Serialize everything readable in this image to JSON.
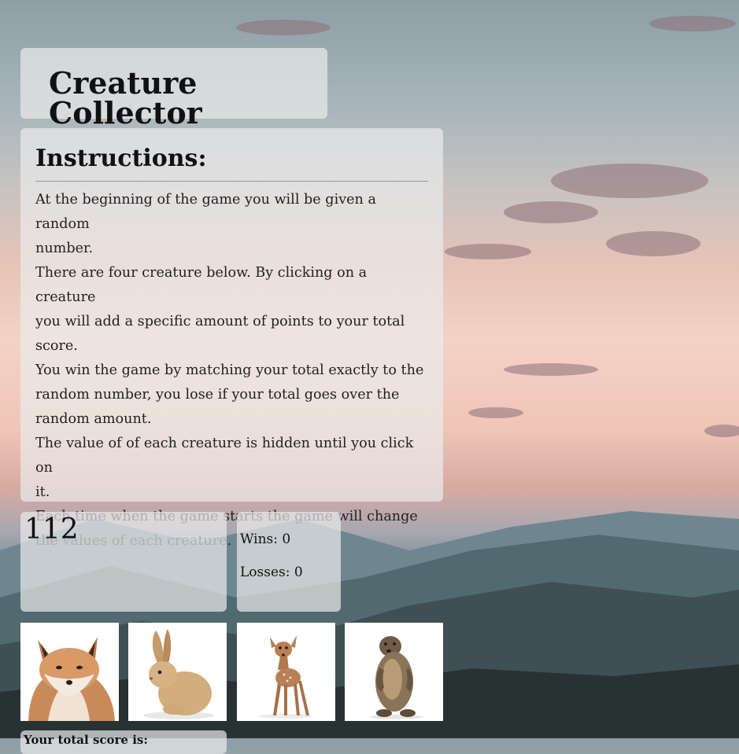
{
  "app": {
    "title": "Creature Collector"
  },
  "instructions": {
    "heading": "Instructions:",
    "lines": [
      "At the beginning of the game you will be given a random",
      "number.",
      "There are four creature below. By clicking on a creature",
      "you will add a specific amount of points to your total",
      "score.",
      "You win the game by matching your total exactly to the",
      "random number, you lose if your total goes over the",
      "random amount.",
      "The value of of each creature is hidden until you click on",
      "it.",
      "Each time when the game starts the game will change",
      "the values of each creature."
    ]
  },
  "score": {
    "target_number": "112"
  },
  "stats": {
    "wins_text": "Wins: 0",
    "losses_text": "Losses: 0"
  },
  "creatures": [
    {
      "icon": "fox-icon"
    },
    {
      "icon": "rabbit-icon"
    },
    {
      "icon": "fawn-icon"
    },
    {
      "icon": "marmot-icon"
    }
  ],
  "message": {
    "text": "Your total score is:"
  }
}
